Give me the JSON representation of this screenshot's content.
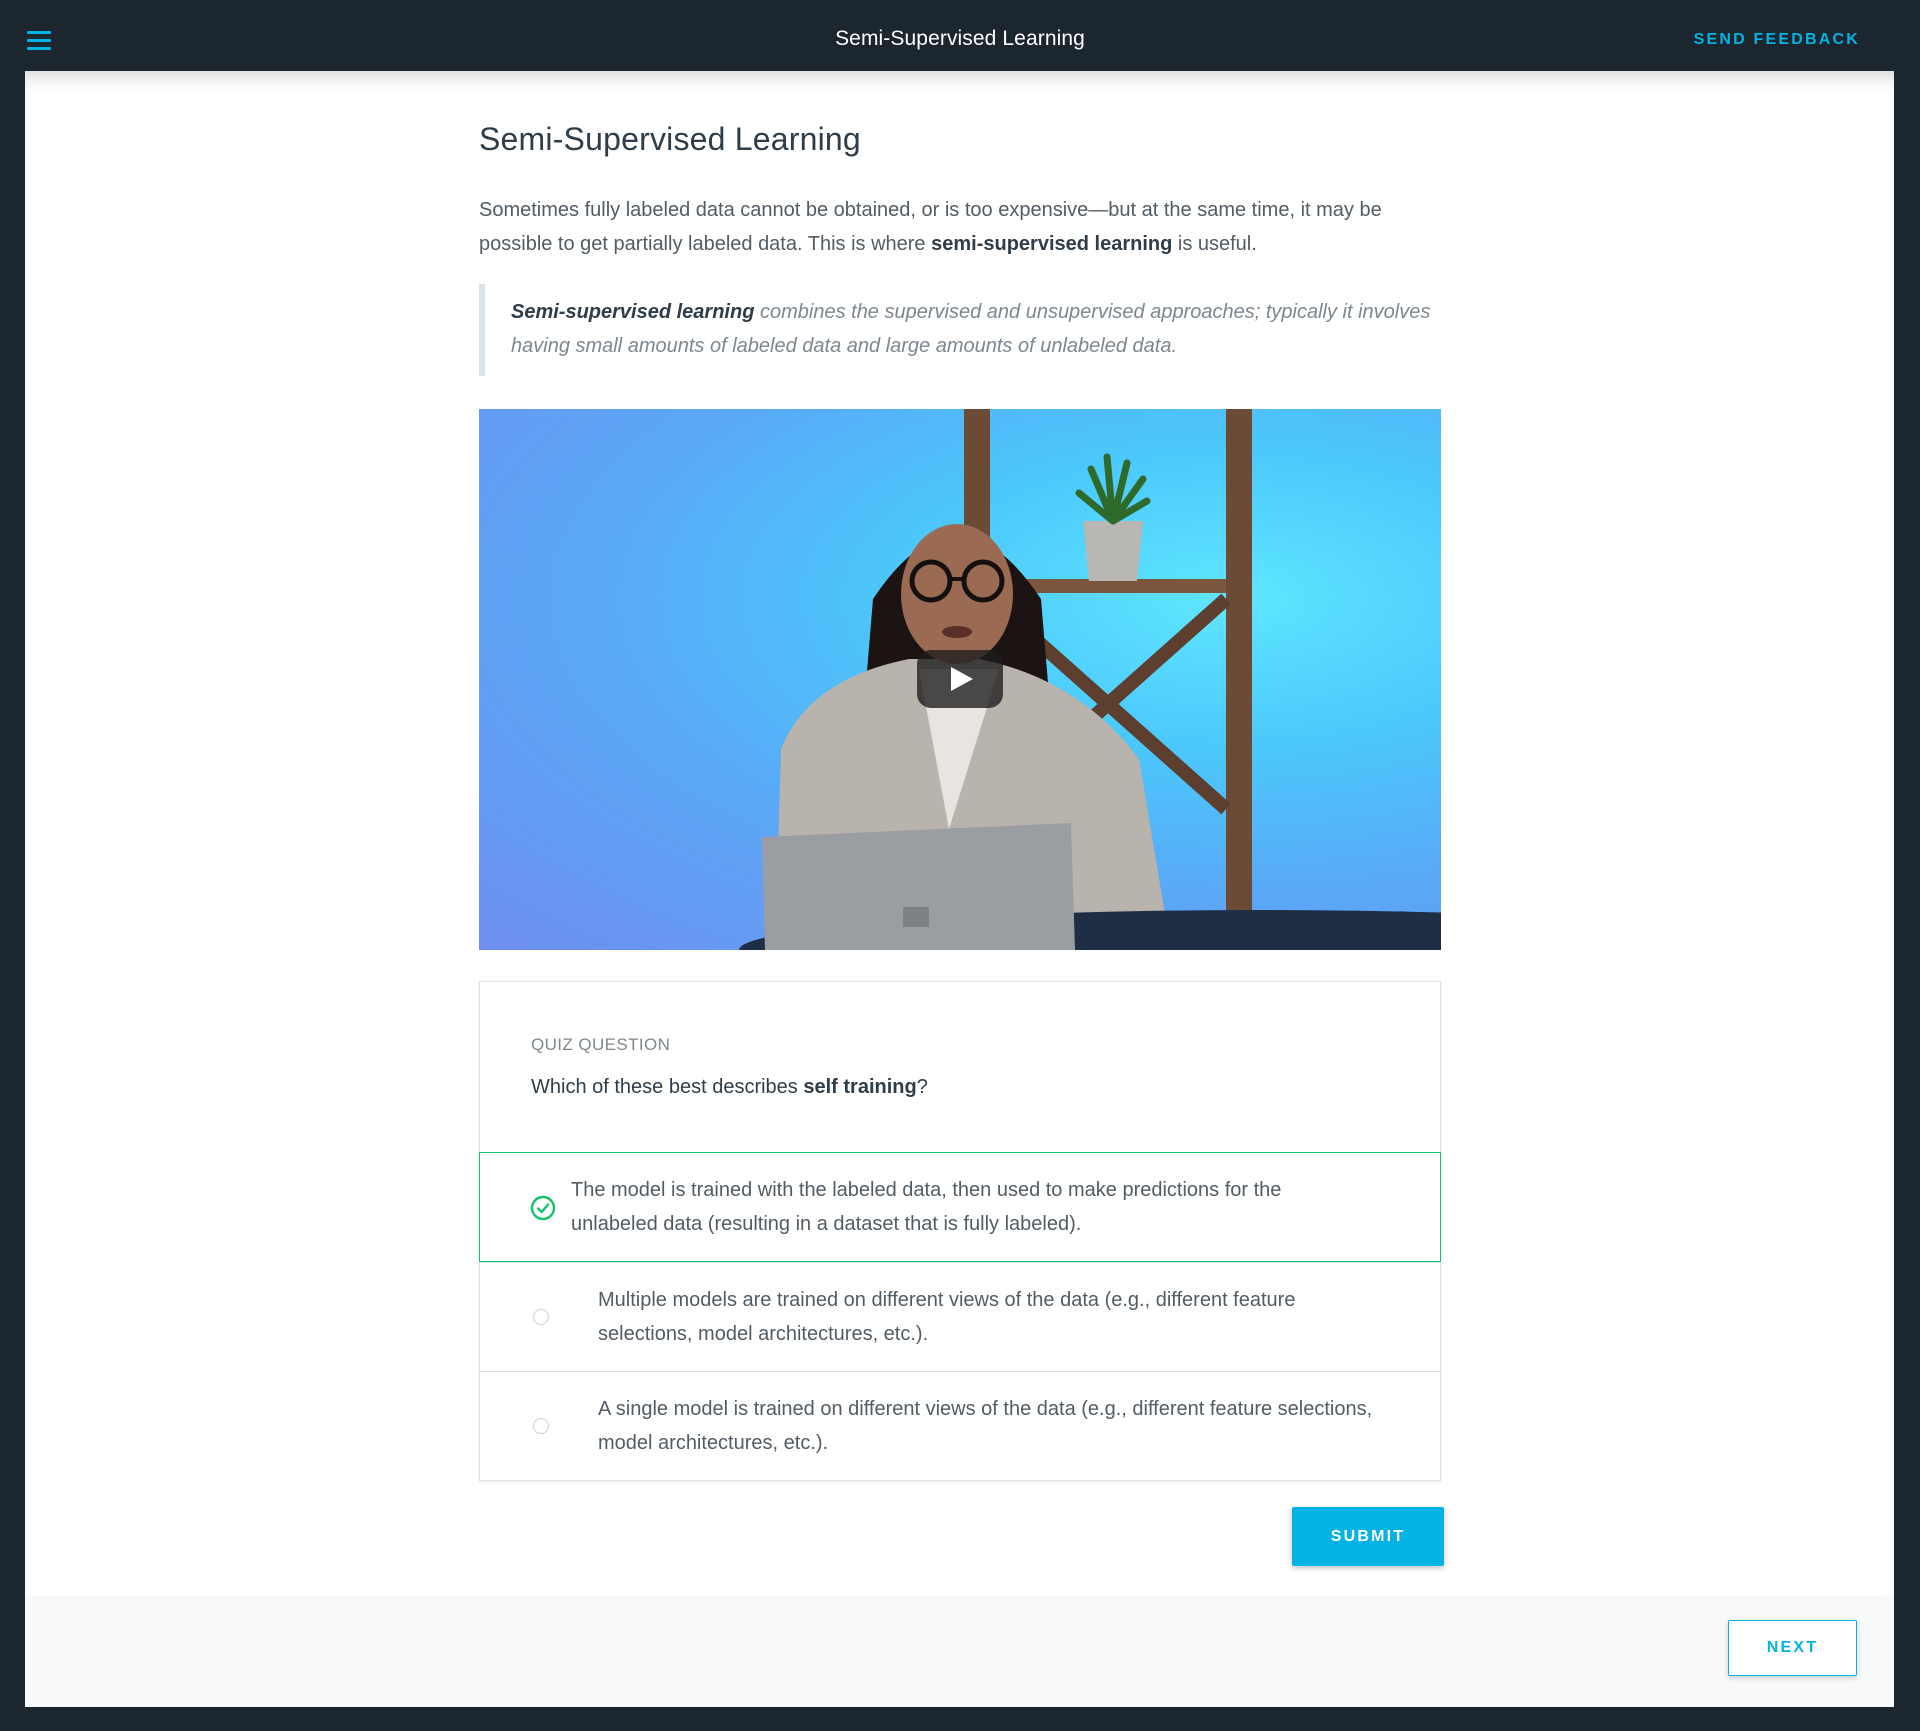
{
  "header": {
    "title": "Semi-Supervised Learning",
    "feedback_label": "SEND FEEDBACK"
  },
  "lesson": {
    "title": "Semi-Supervised Learning",
    "intro_part1": "Sometimes fully labeled data cannot be obtained, or is too expensive—but at the same time, it may be possible to get partially labeled data. This is where ",
    "intro_bold": "semi-supervised learning",
    "intro_part2": " is useful.",
    "quote_bold": "Semi-supervised learning",
    "quote_rest": " combines the supervised and unsupervised approaches; typically it involves having small amounts of labeled data and large amounts of unlabeled data."
  },
  "video": {
    "state": "paused"
  },
  "quiz": {
    "label": "QUIZ QUESTION",
    "question_prefix": "Which of these best describes ",
    "question_bold": "self training",
    "question_suffix": "?",
    "options": [
      {
        "text": "The model is trained with the labeled data, then used to make predictions for the unlabeled data (resulting in a dataset that is fully labeled).",
        "selected": true
      },
      {
        "text": "Multiple models are trained on different views of the data (e.g., different feature selections, model architectures, etc.).",
        "selected": false
      },
      {
        "text": "A single model is trained on different views of the data (e.g., different feature selections, model architectures, etc.).",
        "selected": false
      }
    ],
    "submit_label": "SUBMIT"
  },
  "footer": {
    "next_label": "NEXT"
  },
  "colors": {
    "accent": "#02b3e4",
    "correct": "#15c26b",
    "topbar": "#1c262f"
  }
}
